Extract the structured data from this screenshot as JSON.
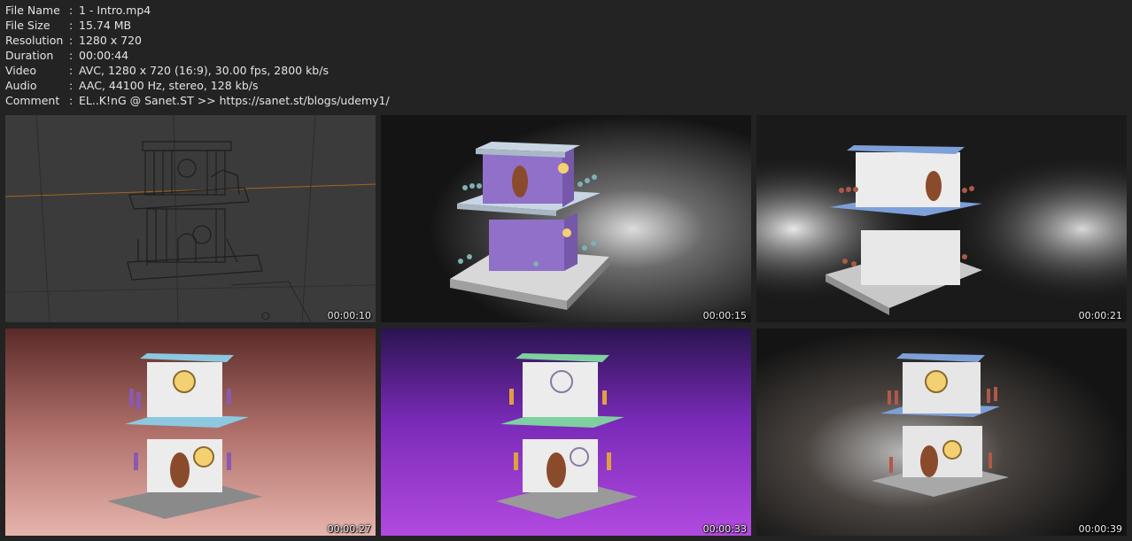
{
  "info": [
    {
      "label": "File Name",
      "value": "1 - Intro.mp4"
    },
    {
      "label": "File Size",
      "value": "15.74 MB"
    },
    {
      "label": "Resolution",
      "value": "1280 x 720"
    },
    {
      "label": "Duration",
      "value": "00:00:44"
    },
    {
      "label": "Video",
      "value": "AVC, 1280 x 720 (16:9), 30.00 fps, 2800 kb/s"
    },
    {
      "label": "Audio",
      "value": "AAC, 44100 Hz, stereo, 128 kb/s"
    },
    {
      "label": "Comment",
      "value": "EL..K!nG @ Sanet.ST >> https://sanet.st/blogs/udemy1/"
    }
  ],
  "separator": ":",
  "thumbnails": [
    {
      "timestamp": "00:00:10"
    },
    {
      "timestamp": "00:00:15"
    },
    {
      "timestamp": "00:00:21"
    },
    {
      "timestamp": "00:00:27"
    },
    {
      "timestamp": "00:00:33"
    },
    {
      "timestamp": "00:00:39"
    }
  ],
  "colors": {
    "page_background": "#232323",
    "text": "#e4e4e4",
    "wireframe_bg": "#3a3a3a",
    "purple_house": "#8f69c8",
    "blue_roof": "#7da0d8",
    "pink_bg": "#c07a74",
    "violet_bg": "#8a2fc4",
    "green_roof": "#7ed0a0",
    "window_glow": "#f4d170",
    "door": "#8a4b2c"
  }
}
